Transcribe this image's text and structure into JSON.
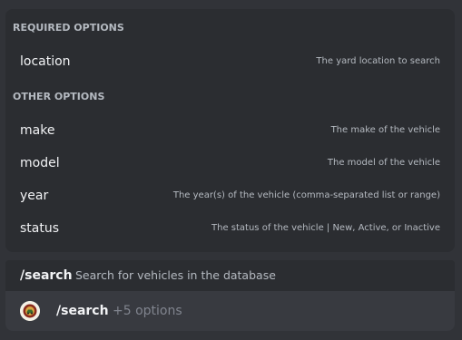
{
  "required_options": {
    "heading": "REQUIRED OPTIONS",
    "items": [
      {
        "name": "location",
        "description": "The yard location to search"
      }
    ]
  },
  "other_options": {
    "heading": "OTHER OPTIONS",
    "items": [
      {
        "name": "make",
        "description": "The make of the vehicle"
      },
      {
        "name": "model",
        "description": "The model of the vehicle"
      },
      {
        "name": "year",
        "description": "The year(s) of the vehicle (comma-separated list or range)"
      },
      {
        "name": "status",
        "description": "The status of the vehicle | New, Active, or Inactive"
      }
    ]
  },
  "command_header": {
    "name": "/search",
    "description": "Search for vehicles in the database"
  },
  "input": {
    "command": "/search",
    "options_hint": "+5 options"
  },
  "colors": {
    "background": "#313338",
    "popup": "#2b2d31",
    "input": "#383a40",
    "text_primary": "#f2f3f5",
    "text_muted": "#b5bac1"
  }
}
